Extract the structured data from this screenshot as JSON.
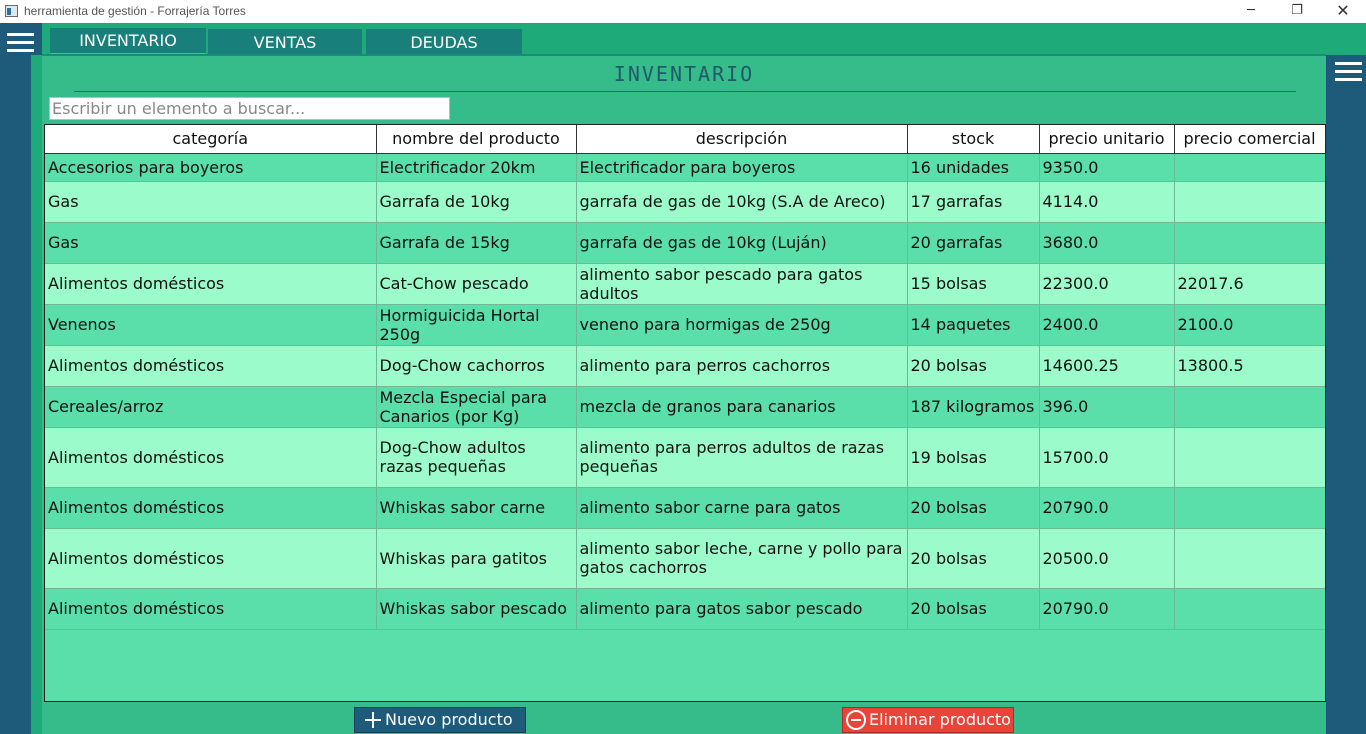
{
  "window": {
    "title": "herramienta de gestión - Forrajería Torres",
    "minimize_glyph": "─",
    "maximize_glyph": "❐",
    "close_glyph": "✕"
  },
  "tabs": [
    {
      "label": "INVENTARIO",
      "active": true
    },
    {
      "label": "VENTAS",
      "active": false
    },
    {
      "label": "DEUDAS",
      "active": false
    }
  ],
  "main": {
    "title": "INVENTARIO",
    "search_placeholder": "Escribir un elemento a buscar..."
  },
  "table": {
    "headers": [
      "categoría",
      "nombre del producto",
      "descripción",
      "stock",
      "precio unitario",
      "precio comercial"
    ],
    "rows": [
      [
        "Accesorios para boyeros",
        "Electrificador 20km",
        "Electrificador para boyeros",
        "16 unidades",
        "9350.0",
        ""
      ],
      [
        "Gas",
        "Garrafa de 10kg",
        "garrafa de gas de 10kg (S.A de Areco)",
        "17 garrafas",
        "4114.0",
        ""
      ],
      [
        "Gas",
        "Garrafa de 15kg",
        "garrafa de gas de 10kg (Luján)",
        "20 garrafas",
        "3680.0",
        ""
      ],
      [
        "Alimentos domésticos",
        "Cat-Chow pescado",
        "alimento sabor pescado para gatos adultos",
        "15 bolsas",
        "22300.0",
        "22017.6"
      ],
      [
        "Venenos",
        "Hormiguicida Hortal 250g",
        "veneno para hormigas de 250g",
        "14 paquetes",
        "2400.0",
        "2100.0"
      ],
      [
        "Alimentos domésticos",
        "Dog-Chow cachorros",
        "alimento para perros cachorros",
        "20 bolsas",
        "14600.25",
        "13800.5"
      ],
      [
        "Cereales/arroz",
        "Mezcla Especial para Canarios (por Kg)",
        "mezcla de granos para canarios",
        "187 kilogramos",
        "396.0",
        ""
      ],
      [
        "Alimentos domésticos",
        "Dog-Chow adultos razas pequeñas",
        "alimento para perros adultos de razas pequeñas",
        "19 bolsas",
        "15700.0",
        ""
      ],
      [
        "Alimentos domésticos",
        "Whiskas sabor carne",
        "alimento sabor carne para gatos",
        "20 bolsas",
        "20790.0",
        ""
      ],
      [
        "Alimentos domésticos",
        "Whiskas para gatitos",
        "alimento sabor leche, carne y pollo para gatos cachorros",
        "20 bolsas",
        "20500.0",
        ""
      ],
      [
        "Alimentos domésticos",
        "Whiskas sabor pescado",
        "alimento para gatos sabor pescado",
        "20 bolsas",
        "20790.0",
        ""
      ]
    ]
  },
  "buttons": {
    "new_product": "Nuevo producto",
    "delete_product": "Eliminar producto"
  },
  "colors": {
    "sidebar": "#1e5a7a",
    "tab": "#187f7a",
    "panel": "#36bc8a",
    "row_odd": "#5adfaa",
    "row_even": "#9bfbca",
    "delete": "#e8443a"
  }
}
